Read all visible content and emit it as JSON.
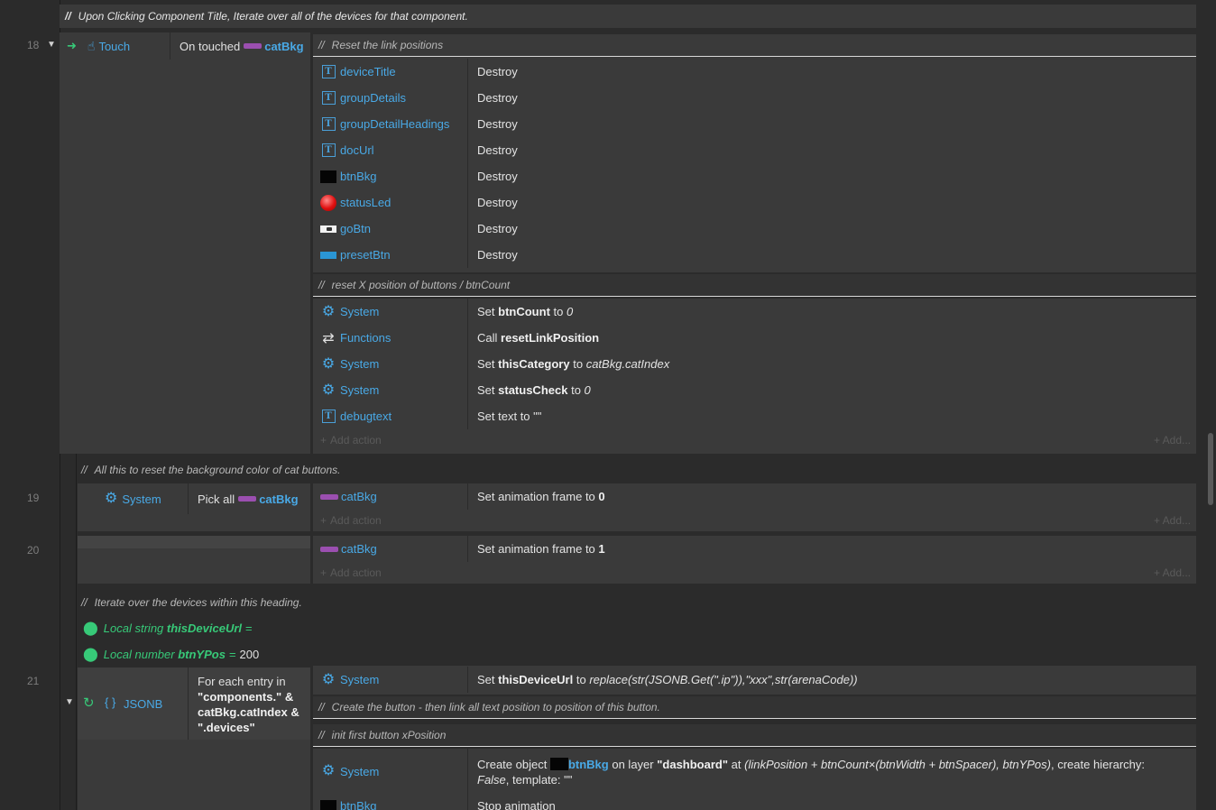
{
  "top_comment": "Upon Clicking Component Title, Iterate over all of the devices for that component.",
  "comment_slash": "//",
  "events": {
    "e18": {
      "number": "18",
      "trigger_object": "Touch",
      "condition_prefix": "On touched",
      "condition_object": "catBkg",
      "comment1": "Reset the link positions",
      "actions1": [
        {
          "object": "deviceTitle",
          "icon": "text-icon",
          "text": "Destroy"
        },
        {
          "object": "groupDetails",
          "icon": "text-icon",
          "text": "Destroy"
        },
        {
          "object": "groupDetailHeadings",
          "icon": "text-icon",
          "text": "Destroy"
        },
        {
          "object": "docUrl",
          "icon": "text-icon",
          "text": "Destroy"
        },
        {
          "object": "btnBkg",
          "icon": "black-sprite-icon",
          "text": "Destroy"
        },
        {
          "object": "statusLed",
          "icon": "red-led-icon",
          "text": "Destroy"
        },
        {
          "object": "goBtn",
          "icon": "go-button-icon",
          "text": "Destroy"
        },
        {
          "object": "presetBtn",
          "icon": "preset-button-icon",
          "text": "Destroy"
        }
      ],
      "comment2": "reset X position of buttons / btnCount",
      "actions2": {
        "a1": {
          "object": "System",
          "pre": "Set",
          "bold": "btnCount",
          "mid": "to",
          "ital": "0"
        },
        "a2": {
          "object": "Functions",
          "pre": "Call",
          "bold": "resetLinkPosition"
        },
        "a3": {
          "object": "System",
          "pre": "Set",
          "bold": "thisCategory",
          "mid": "to",
          "ital": "catBkg.catIndex"
        },
        "a4": {
          "object": "System",
          "pre": "Set",
          "bold": "statusCheck",
          "mid": "to",
          "ital": "0"
        },
        "a5": {
          "object": "debugtext",
          "text": "Set text to \"\""
        }
      },
      "add_action": "Add action",
      "add_right": "Add..."
    },
    "sub_comment": "All this to reset the background color of cat buttons.",
    "e19": {
      "number": "19",
      "trigger_object": "System",
      "condition_prefix": "Pick all",
      "condition_object": "catBkg",
      "action_object": "catBkg",
      "action_text": "Set animation frame to",
      "action_value": "0"
    },
    "e20": {
      "number": "20",
      "action_object": "catBkg",
      "action_text": "Set animation frame to",
      "action_value": "1"
    },
    "iterate_comment": "Iterate over the devices within this heading.",
    "local_string": {
      "kind": "Local string",
      "name": "thisDeviceUrl",
      "eq": "=",
      "value": ""
    },
    "local_number": {
      "kind": "Local number",
      "name": "btnYPos",
      "eq": "=",
      "value": "200"
    },
    "e21": {
      "number": "21",
      "trigger_object": "JSONB",
      "condition_text": "For each entry in",
      "condition_line1": "\"components.\" &",
      "condition_line2": "catBkg.catIndex &",
      "condition_line3": "\".devices\"",
      "action1_object": "System",
      "action1_pre": "Set",
      "action1_bold": "thisDeviceUrl",
      "action1_mid": "to",
      "action1_ital": "replace(str(JSONB.Get(\".ip\")),\"xxx\",str(arenaCode))",
      "comment_a": "Create the button - then link all text position to position of this button.",
      "comment_b": "init first button xPosition",
      "create": {
        "object": "System",
        "pre": "Create object",
        "obj": "btnBkg",
        "layer_pre": "on layer",
        "layer": "\"dashboard\"",
        "at": "at",
        "expr": "(linkPosition + btnCount×(btnWidth + btnSpacer), btnYPos)",
        "hier": ", create hierarchy:",
        "hier_val": "False",
        "tmpl": "template: \"\""
      },
      "last_object": "btnBkg",
      "last_text": "Stop animation"
    }
  }
}
